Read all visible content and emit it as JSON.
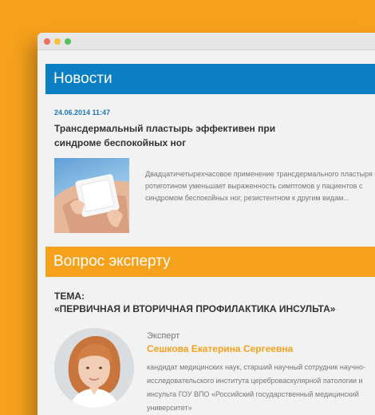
{
  "news": {
    "header": "Новости",
    "date": "24.06.2014 11:47",
    "title": "Трансдермальный пластырь эффективен при синдроме беспокойных ног",
    "text": "Двадцатичетырехчасовое применение трансдермального пластыря с ротиготином уменьшает выраженность симптомов у пациентов с синдромом беспокойных ног, резистентном к другим видам..."
  },
  "expert_section": {
    "header": "Вопрос эксперту",
    "topic_label": "ТЕМА:",
    "topic_title": "«ПЕРВИЧНАЯ И ВТОРИЧНАЯ ПРОФИЛАКТИКА ИНСУЛЬТА»",
    "caption": "Эксперт",
    "name": "Сешкова Екатерина Сергеевна",
    "description": "кандидат медицинских наук, старший научный сотрудник научно-исследовательского института цереброваскулярной патологии и инсульта ГОУ ВПО «Российский государственный медицинский университет»"
  },
  "colors": {
    "background": "#f6a11c",
    "news_header": "#0b7fc4",
    "expert_header": "#f6a11c",
    "date": "#1f78b4"
  }
}
